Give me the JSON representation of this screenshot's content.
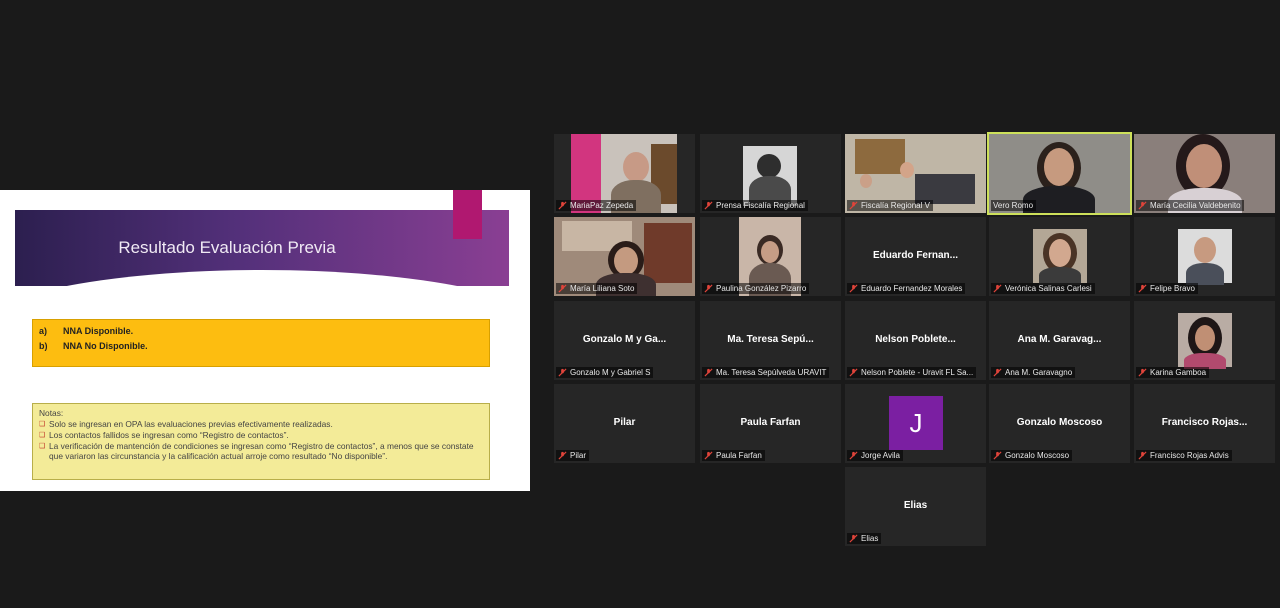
{
  "slide": {
    "title": "Resultado Evaluación Previa",
    "options": [
      {
        "letter": "a)",
        "text": "NNA Disponible."
      },
      {
        "letter": "b)",
        "text": "NNA No Disponible."
      }
    ],
    "notes_title": "Notas:",
    "notes": [
      "Solo se ingresan en OPA las evaluaciones previas efectivamente realizadas.",
      "Los contactos fallidos se ingresan como “Registro de contactos”.",
      "La verificación de mantención de condiciones se ingresan como “Registro de contactos”, a menos que se constate que variaron las circunstancia y la calificación actual arroje como resultado “No disponible”."
    ]
  },
  "participants": [
    {
      "label": "MariaPaz Zepeda"
    },
    {
      "label": "Prensa Fiscalía Regional"
    },
    {
      "label": "Fiscalía Regional V"
    },
    {
      "label": "Vero Romo"
    },
    {
      "label": "María Cecilia Valdebenito"
    },
    {
      "label": "María Liliana Soto"
    },
    {
      "label": "Paulina González Pizarro"
    },
    {
      "label": "Eduardo Fernandez Morales",
      "display": "Eduardo  Fernan..."
    },
    {
      "label": "Verónica Salinas Carlesi"
    },
    {
      "label": "Felipe Bravo"
    },
    {
      "label": "Gonzalo M y Gabriel S",
      "display": "Gonzalo M y Ga..."
    },
    {
      "label": "Ma. Teresa Sepúlveda URAVIT",
      "display": "Ma. Teresa Sepú..."
    },
    {
      "label": "Nelson Poblete - Uravit FL Sa...",
      "display": "Nelson Poblete..."
    },
    {
      "label": "Ana M. Garavagno",
      "display": "Ana M. Garavag..."
    },
    {
      "label": "Karina Gamboa"
    },
    {
      "label": "Pilar",
      "display": "Pilar"
    },
    {
      "label": "Paula Farfan",
      "display": "Paula Farfan"
    },
    {
      "label": "Jorge Avila",
      "avatar": "J"
    },
    {
      "label": "Gonzalo Moscoso",
      "display": "Gonzalo Moscoso"
    },
    {
      "label": "Francisco Rojas Advis",
      "display": "Francisco  Rojas..."
    },
    {
      "label": "Elias",
      "display": "Elias"
    }
  ],
  "colors": {
    "active_speaker_border": "#cde05a",
    "muted_icon": "#e0443a",
    "avatar_j": "#7b1fa2"
  }
}
